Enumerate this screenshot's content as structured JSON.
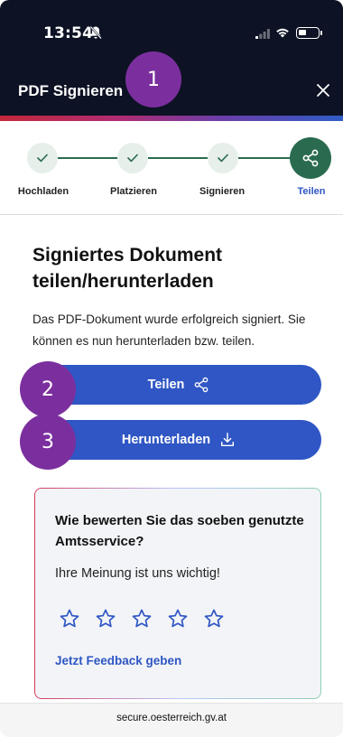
{
  "status_bar": {
    "time": "13:54",
    "battery_level": 0.4
  },
  "header": {
    "title": "PDF Signieren"
  },
  "markers": [
    "1",
    "2",
    "3"
  ],
  "stepper": {
    "steps": [
      {
        "label": "Hochladen",
        "state": "done"
      },
      {
        "label": "Platzieren",
        "state": "done"
      },
      {
        "label": "Signieren",
        "state": "done"
      },
      {
        "label": "Teilen",
        "state": "active"
      }
    ]
  },
  "main": {
    "title": "Signiertes Dokument teilen/herunterladen",
    "description": "Das PDF-Dokument wurde erfolgreich signiert. Sie können es nun herunterladen bzw. teilen.",
    "share_label": "Teilen",
    "download_label": "Herunterladen"
  },
  "feedback": {
    "title": "Wie bewerten Sie das soeben genutzte Amtsservice?",
    "subtitle": "Ihre Meinung ist uns wichtig!",
    "star_count": 5,
    "link": "Jetzt Feedback geben"
  },
  "browser": {
    "url": "secure.oesterreich.gv.at"
  },
  "colors": {
    "header_bg": "#0d1224",
    "primary": "#2f56c4",
    "step_green": "#2a6b4f",
    "marker": "#7b2f9e"
  }
}
